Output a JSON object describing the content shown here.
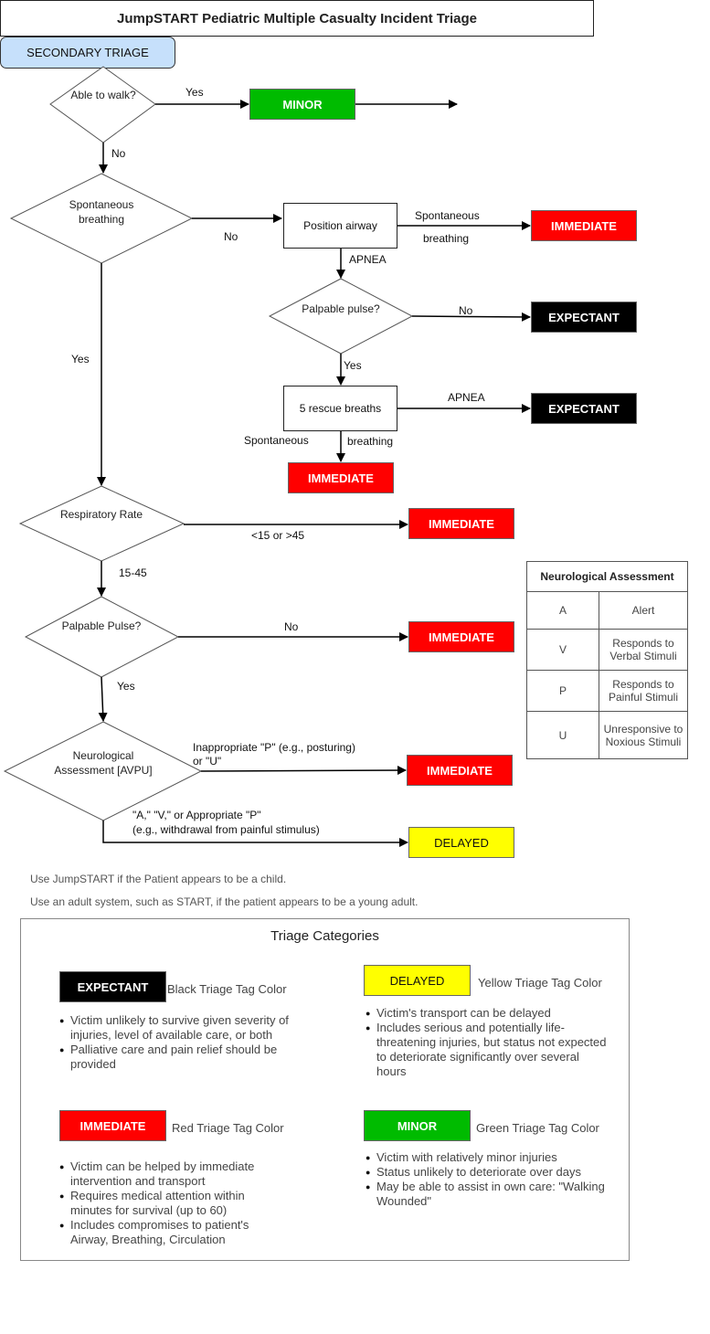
{
  "title": "JumpSTART Pediatric Multiple Casualty Incident Triage",
  "colors": {
    "immediate": "#ff0000",
    "expectant": "#000000",
    "minor": "#00bb00",
    "delayed": "#ffff00",
    "secondary": "#c6e0fb"
  },
  "nodes": {
    "walk": "Able to walk?",
    "minor": "MINOR",
    "secondary": "SECONDARY TRIAGE",
    "spont": "Spontaneous breathing",
    "position_airway": "Position airway",
    "immediate_1": "IMMEDIATE",
    "pulse_1": "Palpable pulse?",
    "expectant_1": "EXPECTANT",
    "rescue": "5 rescue breaths",
    "expectant_2": "EXPECTANT",
    "immediate_2": "IMMEDIATE",
    "resp": "Respiratory Rate",
    "immediate_3": "IMMEDIATE",
    "pulse_2": "Palpable Pulse?",
    "immediate_4": "IMMEDIATE",
    "neuro": "Neurological Assessment [AVPU]",
    "immediate_5": "IMMEDIATE",
    "delayed": "DELAYED"
  },
  "edges": {
    "walk_yes": "Yes",
    "walk_no": "No",
    "spont_no": "No",
    "spont_yes": "Yes",
    "airway_spont_top": "Spontaneous",
    "airway_spont_bottom": "breathing",
    "airway_apnea": "APNEA",
    "pulse1_no": "No",
    "pulse1_yes": "Yes",
    "rescue_apnea": "APNEA",
    "rescue_spont_left": "Spontaneous",
    "rescue_spont_right": "breathing",
    "resp_abnormal": "<15 or >45",
    "resp_normal": "15-45",
    "pulse2_no": "No",
    "pulse2_yes": "Yes",
    "neuro_bad_1": "Inappropriate \"P\" (e.g., posturing)",
    "neuro_bad_2": "or \"U\"",
    "neuro_good_1": "\"A,\" \"V,\" or Appropriate \"P\"",
    "neuro_good_2": "(e.g., withdrawal from painful stimulus)"
  },
  "neuro_table": {
    "header": "Neurological Assessment",
    "rows": [
      {
        "code": "A",
        "desc": "Alert"
      },
      {
        "code": "V",
        "desc": "Responds to Verbal Stimuli"
      },
      {
        "code": "P",
        "desc": "Responds to Painful Stimuli"
      },
      {
        "code": "U",
        "desc": "Unresponsive to Noxious Stimuli"
      }
    ]
  },
  "notes": [
    "Use JumpSTART if the Patient appears to be a child.",
    "Use an adult system, such as START, if the patient appears to be a young adult."
  ],
  "categories": {
    "title": "Triage Categories",
    "expectant": {
      "tag": "EXPECTANT",
      "color_label": "Black Triage Tag Color",
      "bullets": [
        "Victim unlikely to survive given severity of injuries, level of available care, or both",
        "Palliative care and pain relief should be provided"
      ]
    },
    "delayed": {
      "tag": "DELAYED",
      "color_label": "Yellow Triage Tag Color",
      "bullets": [
        "Victim's transport can be delayed",
        "Includes serious and potentially life-threatening injuries, but status not expected to deteriorate significantly over several hours"
      ]
    },
    "immediate": {
      "tag": "IMMEDIATE",
      "color_label": "Red Triage Tag Color",
      "bullets": [
        "Victim can be helped by immediate intervention and transport",
        "Requires medical attention within minutes for survival (up to 60)",
        "Includes compromises to patient's Airway, Breathing, Circulation"
      ]
    },
    "minor": {
      "tag": "MINOR",
      "color_label": "Green Triage Tag Color",
      "bullets": [
        "Victim with relatively minor injuries",
        "Status unlikely to deteriorate over days",
        "May be able to assist in own care: \"Walking Wounded\""
      ]
    }
  }
}
